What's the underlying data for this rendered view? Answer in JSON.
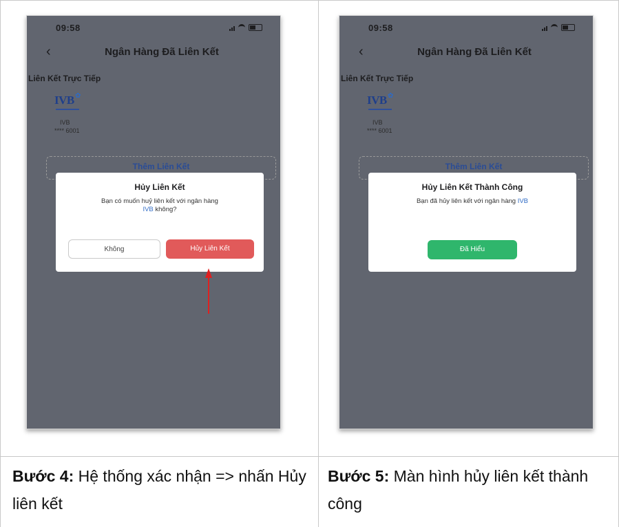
{
  "left_phone": {
    "status_time": "09:58",
    "nav_title": "Ngân Hàng Đã Liên Kết",
    "section_label": "Liên Kết Trực Tiếp",
    "bank_logo_text": "IVB",
    "bank_name": "IVB",
    "bank_account": "**** 6001",
    "add_link_label": "Thêm Liên Kết",
    "dialog": {
      "title": "Hủy Liên Kết",
      "message_prefix": "Bạn có muốn huỷ liên kết với ngân hàng",
      "message_bank": "IVB",
      "message_suffix": "không?",
      "no_button": "Không",
      "confirm_button": "Hủy Liên Kết"
    }
  },
  "right_phone": {
    "status_time": "09:58",
    "nav_title": "Ngân Hàng Đã Liên Kết",
    "section_label": "Liên Kết Trực Tiếp",
    "bank_logo_text": "IVB",
    "bank_name": "IVB",
    "bank_account": "**** 6001",
    "add_link_label": "Thêm Liên Kết",
    "dialog": {
      "title": "Hủy Liên Kết Thành Công",
      "message_prefix": "Bạn đã hủy liên kết với ngân hàng",
      "message_bank": "IVB",
      "ok_button": "Đã Hiểu"
    }
  },
  "captions": {
    "left_step": "Bước 4:",
    "left_text": "Hệ thống xác nhận => nhấn Hủy liên kết",
    "right_step": "Bước 5:",
    "right_text": "Màn hình hủy liên kết thành công"
  },
  "colors": {
    "overlay": "#61656f",
    "cancel_red": "#e15a5a",
    "ok_green": "#2fb66c",
    "link_blue": "#2f6bc5",
    "arrow_red": "#e02020"
  }
}
